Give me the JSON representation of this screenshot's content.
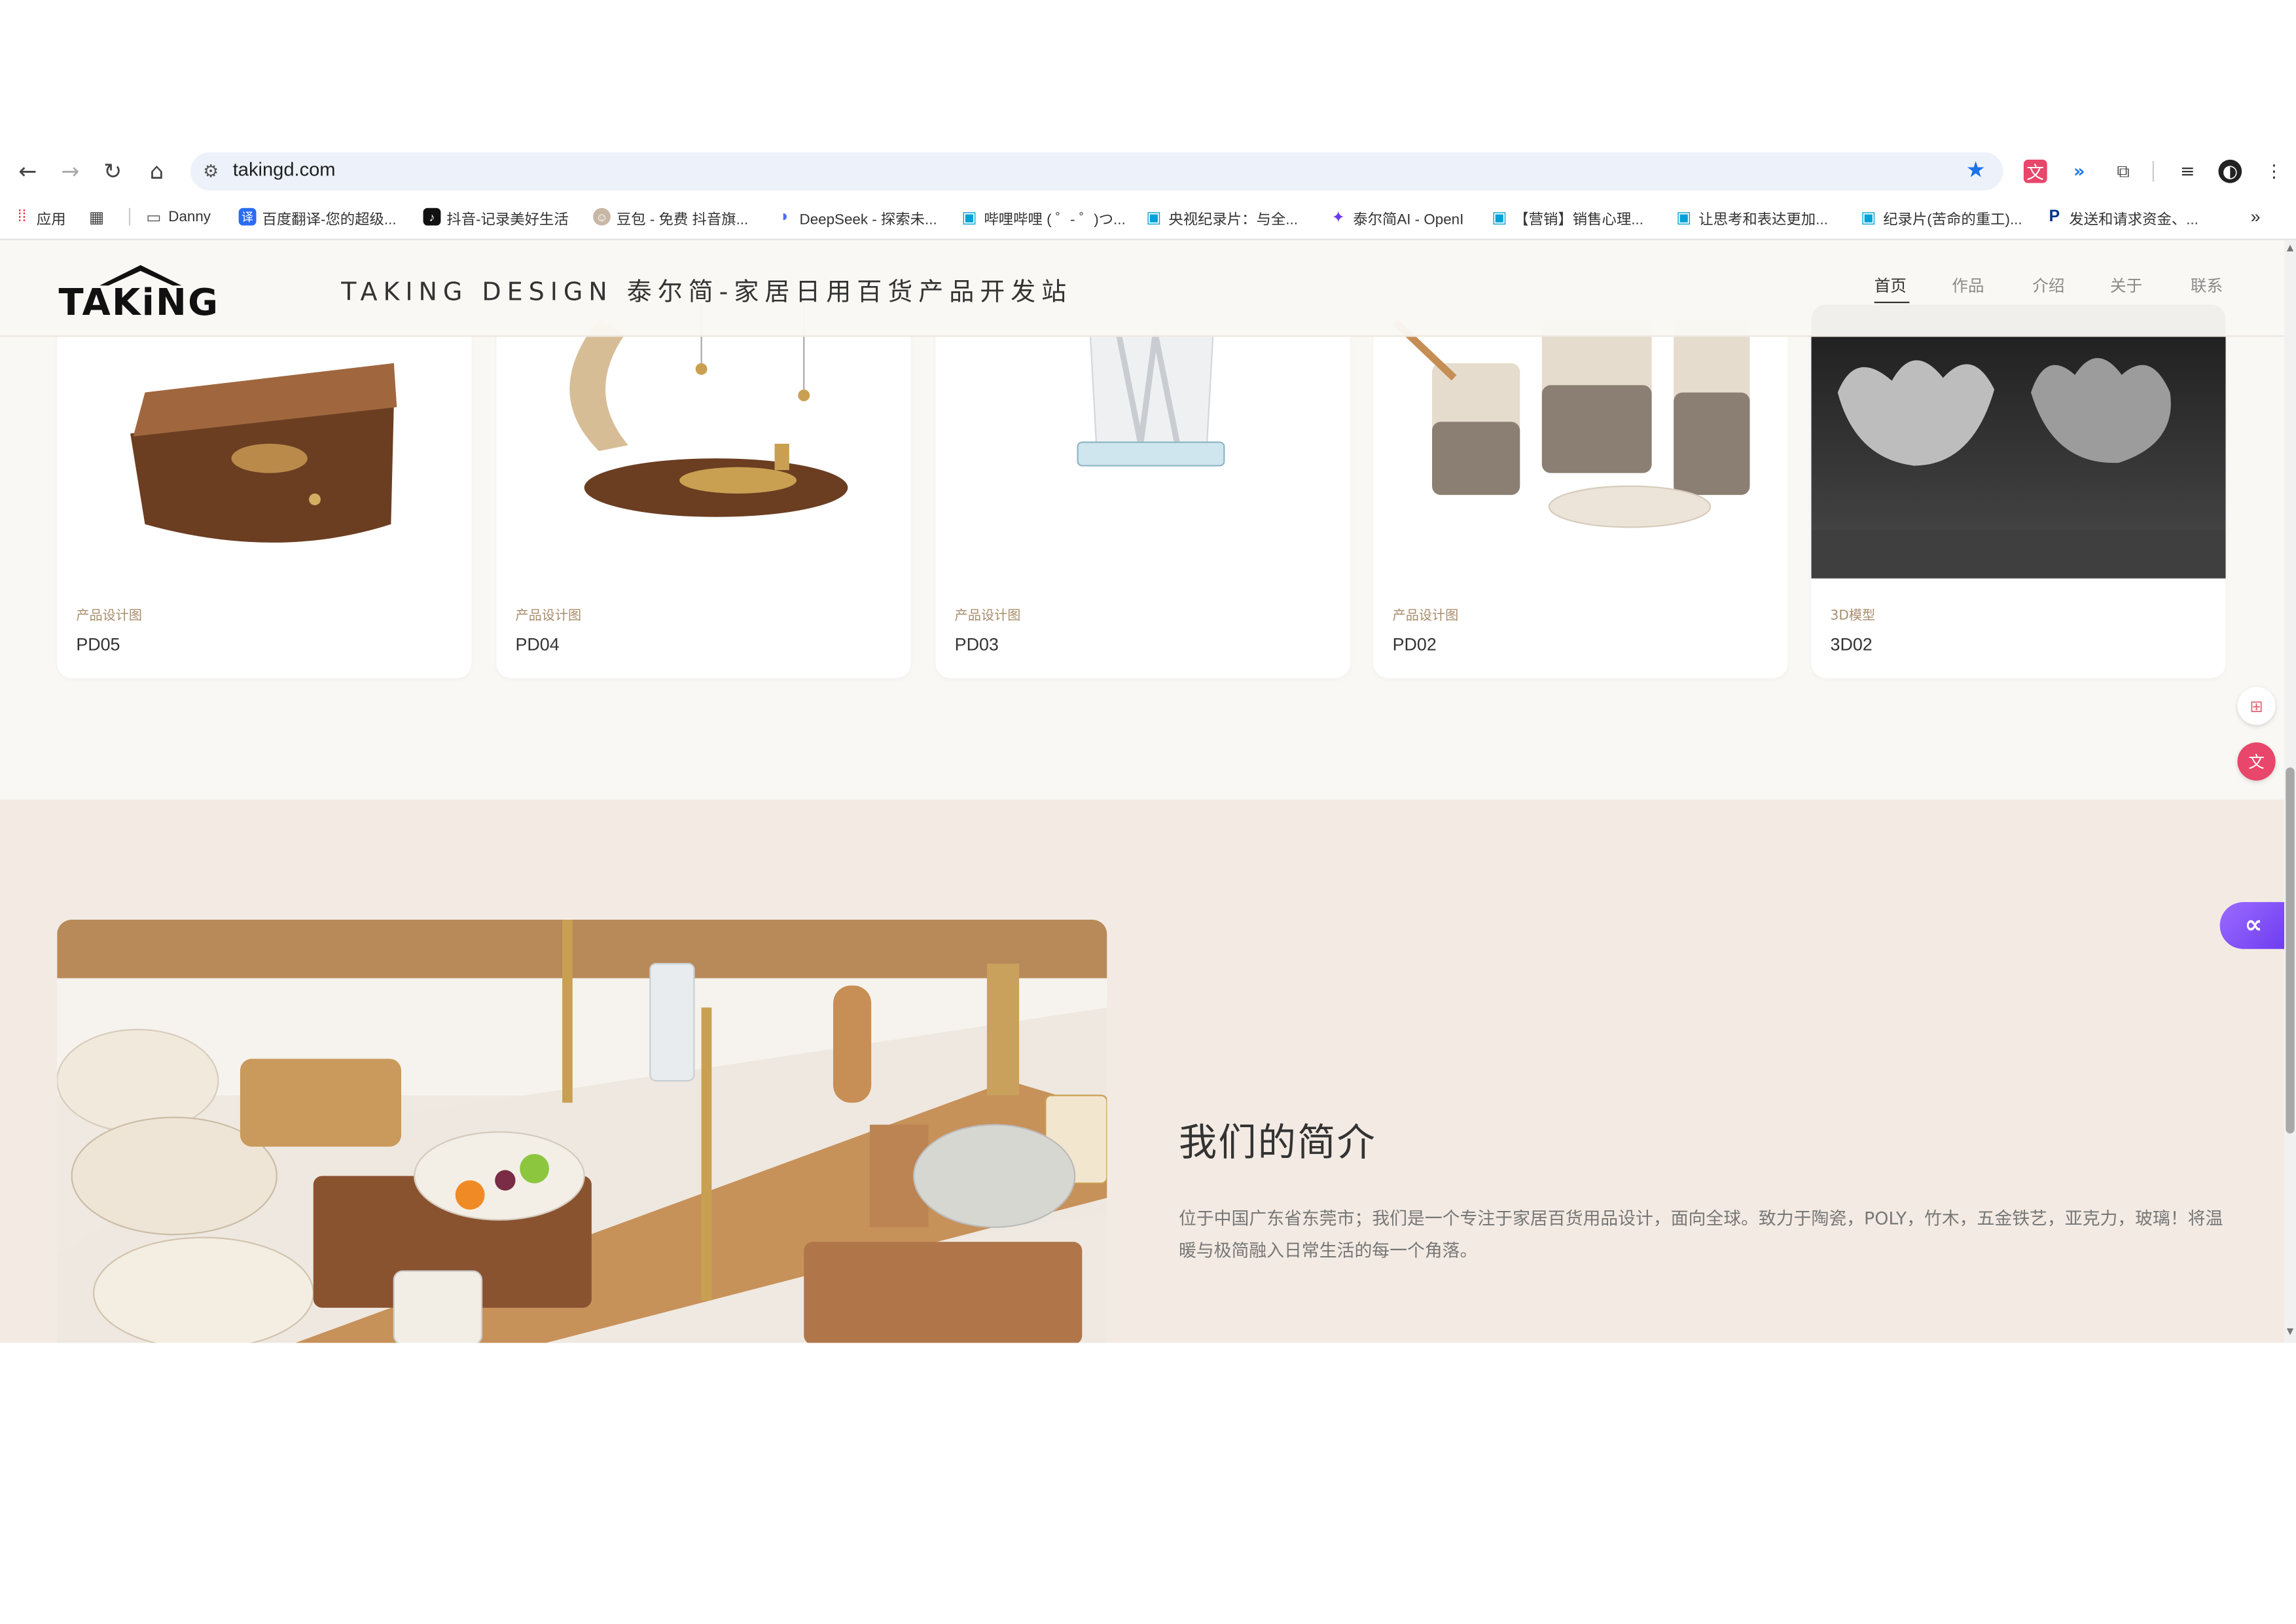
{
  "browser": {
    "url": "takingd.com",
    "bookmarks": [
      {
        "label": "应用",
        "icon": "apps-grid-icon"
      },
      {
        "label": "",
        "icon": "tab-groups-icon"
      },
      {
        "label": "Danny",
        "icon": "folder-icon"
      },
      {
        "label": "百度翻译-您的超级...",
        "icon": "baidu-translate-icon"
      },
      {
        "label": "抖音-记录美好生活",
        "icon": "douyin-icon"
      },
      {
        "label": "豆包 - 免费 抖音旗...",
        "icon": "doubao-icon"
      },
      {
        "label": "DeepSeek - 探索未...",
        "icon": "deepseek-icon"
      },
      {
        "label": "哔哩哔哩 ( ゜- ゜)つ...",
        "icon": "bilibili-icon"
      },
      {
        "label": "央视纪录片：与全...",
        "icon": "bilibili-icon"
      },
      {
        "label": "泰尔简AI - OpenI",
        "icon": "openi-icon"
      },
      {
        "label": "【营销】销售心理...",
        "icon": "bilibili-icon"
      },
      {
        "label": "让思考和表达更加...",
        "icon": "bilibili-icon"
      },
      {
        "label": "纪录片(苦命的重工)...",
        "icon": "bilibili-icon"
      },
      {
        "label": "发送和请求资金、...",
        "icon": "paypal-icon"
      }
    ]
  },
  "site": {
    "logo": "TAKiNG",
    "title": "TAKING DESIGN 泰尔简-家居日用百货产品开发站",
    "nav": [
      {
        "label": "首页",
        "active": true
      },
      {
        "label": "作品",
        "active": false
      },
      {
        "label": "介绍",
        "active": false
      },
      {
        "label": "关于",
        "active": false
      },
      {
        "label": "联系",
        "active": false
      }
    ]
  },
  "cards": [
    {
      "category": "产品设计图",
      "name": "PD05",
      "image": "walnut-jewelry-box"
    },
    {
      "category": "产品设计图",
      "name": "PD04",
      "image": "jewelry-stand-tray"
    },
    {
      "category": "产品设计图",
      "name": "PD03",
      "image": "glass-soap-dispenser"
    },
    {
      "category": "产品设计图",
      "name": "PD02",
      "image": "ceramic-bath-set"
    },
    {
      "category": "3D模型",
      "name": "3D02",
      "image": "3d-bowl-render"
    }
  ],
  "intro": {
    "title": "我们的简介",
    "text": "位于中国广东省东莞市；我们是一个专注于家居百货用品设计，面向全球。致力于陶瓷，POLY，竹木，五金铁艺，亚克力，玻璃！将温暖与极简融入日常生活的每一个角落。"
  },
  "colors": {
    "page_bg": "#faf8f4",
    "intro_bg": "#f3ebe3",
    "accent_text": "#a88d6c",
    "bookmark_star": "#1a73e8",
    "ai_button": "#7b4cf5"
  }
}
